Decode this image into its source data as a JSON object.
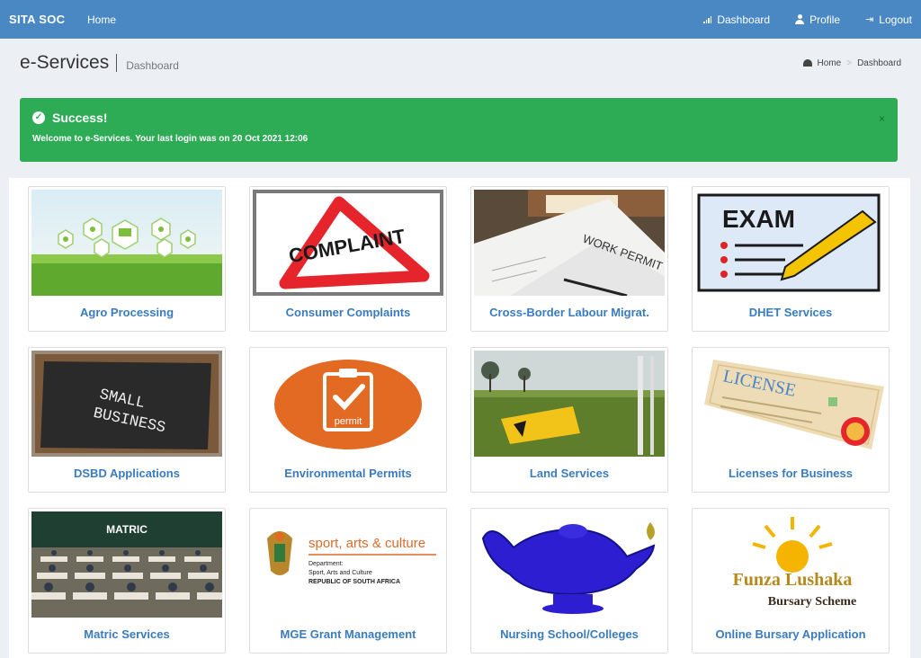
{
  "navbar": {
    "brand": "SITA SOC",
    "home": "Home",
    "dashboard": "Dashboard",
    "profile": "Profile",
    "logout": "Logout"
  },
  "header": {
    "title": "e-Services",
    "subtitle": "Dashboard",
    "breadcrumb": [
      "Home",
      "Dashboard"
    ]
  },
  "alert": {
    "title": "Success!",
    "message": "Welcome to e-Services. Your last login was on 20 Oct 2021 12:06",
    "close": "×"
  },
  "services": [
    {
      "label": "Agro Processing",
      "icon": "smart-agriculture-image"
    },
    {
      "label": "Consumer Complaints",
      "icon": "complaint-sign-image",
      "image_text": "COMPLAINT"
    },
    {
      "label": "Cross-Border Labour Migrat.",
      "icon": "work-permit-image",
      "image_text": "WORK PERMIT"
    },
    {
      "label": "DHET Services",
      "icon": "exam-image",
      "image_text": "EXAM"
    },
    {
      "label": "DSBD Applications",
      "icon": "small-business-image",
      "image_text": "SMALL BUSINESS"
    },
    {
      "label": "Environmental Permits",
      "icon": "permit-clipboard-image",
      "image_text": "permit"
    },
    {
      "label": "Land Services",
      "icon": "land-field-image"
    },
    {
      "label": "Licenses for Business",
      "icon": "license-certificate-image",
      "image_text": "LICENSE"
    },
    {
      "label": "Matric Services",
      "icon": "matric-exam-hall-image",
      "image_text": "MATRIC"
    },
    {
      "label": "MGE Grant Management",
      "icon": "sport-arts-culture-logo",
      "image_text": "sport, arts & culture",
      "image_sub": [
        "Department:",
        "Sport, Arts and Culture",
        "REPUBLIC OF SOUTH AFRICA"
      ]
    },
    {
      "label": "Nursing School/Colleges",
      "icon": "nursing-lamp-image"
    },
    {
      "label": "Online Bursary Application",
      "icon": "funza-lushaka-logo",
      "image_text": "Funza Lushaka",
      "image_sub": [
        "Bursary Scheme"
      ]
    }
  ]
}
